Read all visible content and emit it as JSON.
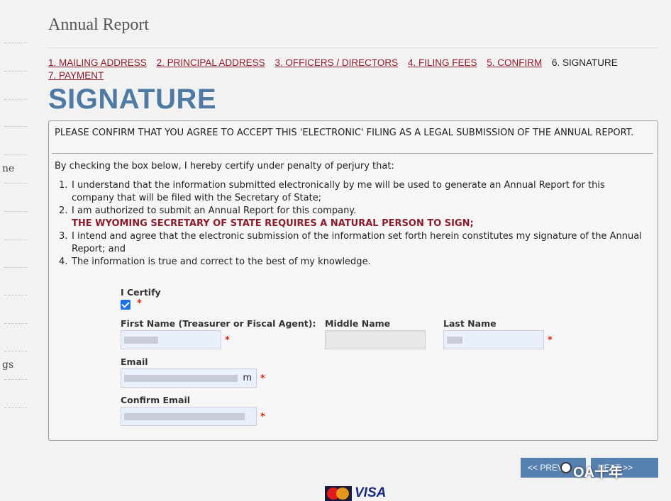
{
  "sidebar": {
    "frag1": "ne",
    "frag2": "gs"
  },
  "page": {
    "title": "Annual Report"
  },
  "steps": [
    {
      "label": "1. MAILING ADDRESS"
    },
    {
      "label": "2. PRINCIPAL ADDRESS"
    },
    {
      "label": "3. OFFICERS / DIRECTORS"
    },
    {
      "label": "4. FILING FEES"
    },
    {
      "label": "5. CONFIRM"
    },
    {
      "label": "6. SIGNATURE"
    },
    {
      "label": "7. PAYMENT"
    }
  ],
  "heading": "SIGNATURE",
  "panel": {
    "confirm_text": "PLEASE CONFIRM THAT YOU AGREE TO ACCEPT THIS 'ELECTRONIC' FILING AS A LEGAL SUBMISSION OF THE ANNUAL REPORT.",
    "intro": "By checking the box below, I hereby certify under penalty of perjury that:",
    "items": [
      {
        "num": "1.",
        "text": "I understand that the information submitted electronically by me will be used to generate an Annual Report for this company that will be filed with the Secretary of State;"
      },
      {
        "num": "2.",
        "text": "I am authorized to submit an Annual Report for this company.",
        "warning": "THE WYOMING SECRETARY OF STATE REQUIRES A NATURAL PERSON TO SIGN;"
      },
      {
        "num": "3.",
        "text": "I intend and agree that the electronic submission of the information set forth herein constitutes my signature of the Annual Report; and"
      },
      {
        "num": "4.",
        "text": "The information is true and correct to the best of my knowledge."
      }
    ]
  },
  "form": {
    "certify_label": "I Certify",
    "certify_checked": true,
    "required_mark": "*",
    "first_name_label": "First Name (Treasurer or Fiscal Agent):",
    "middle_name_label": "Middle Name",
    "last_name_label": "Last Name",
    "email_label": "Email",
    "email_visible_suffix": "m",
    "confirm_email_label": "Confirm Email"
  },
  "buttons": {
    "previous": "<< PREVI",
    "next": "NEXT >>"
  },
  "watermark": "OA十年",
  "payment_logos": {
    "visa": "VISA"
  },
  "colors": {
    "link": "#8b1c2b",
    "heading": "#4e7aa3",
    "button": "#5580b0",
    "required": "#dd2211"
  }
}
